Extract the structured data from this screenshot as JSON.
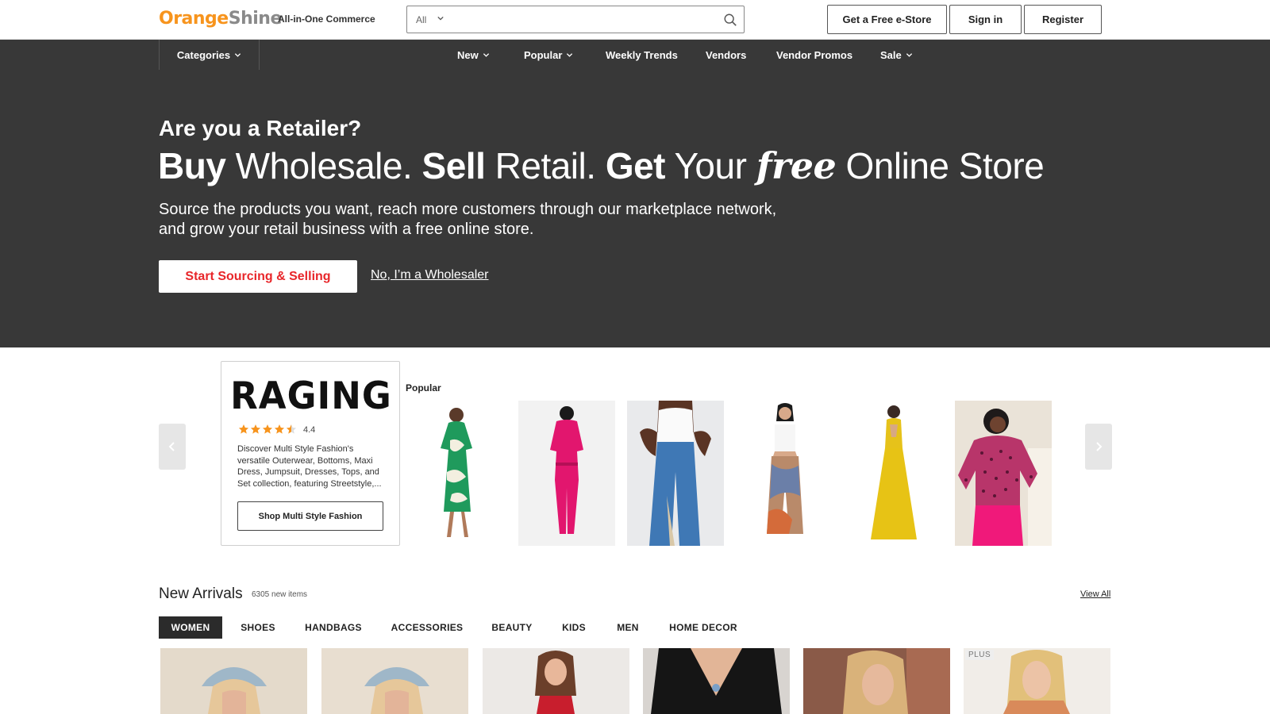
{
  "header": {
    "logo_part1": "Orange",
    "logo_part2": "Shine",
    "tagline": "All-in-One Commerce",
    "search_category": "All",
    "search_placeholder": "",
    "buttons": {
      "estore": "Get a Free e-Store",
      "signin": "Sign in",
      "register": "Register"
    }
  },
  "nav": {
    "categories": "Categories",
    "items": [
      {
        "label": "New"
      },
      {
        "label": "Popular"
      },
      {
        "label": "Weekly Trends"
      },
      {
        "label": "Vendors"
      },
      {
        "label": "Vendor Promos"
      },
      {
        "label": "Sale"
      }
    ]
  },
  "hero": {
    "question": "Are you a Retailer?",
    "headline": {
      "w1": "Buy",
      "w2": " Wholesale. ",
      "w3": "Sell",
      "w4": " Retail. ",
      "w5": "Get",
      "w6": " Your ",
      "w7": "free",
      "w8": " Online Store"
    },
    "sub_line1": "Source the products you want, reach more customers through our marketplace network,",
    "sub_line2": "and grow your retail business with a free online store.",
    "cta": "Start Sourcing & Selling",
    "alt_link": "No, I’m a Wholesaler"
  },
  "featured": {
    "vendor_logo": "RAGING",
    "rating": "4.4",
    "rating_value": 4.4,
    "description": "Discover Multi Style Fashion's versatile Outerwear, Bottoms, Maxi Dress, Jumpsuit, Dresses, Tops, and Set collection, featuring Streetstyle,...",
    "button": "Shop Multi Style Fashion",
    "popular_label": "Popular",
    "products": [
      {
        "name": "green-print-dress"
      },
      {
        "name": "magenta-jumpsuit"
      },
      {
        "name": "flare-jeans-bodysuit"
      },
      {
        "name": "printed-pants-outfit"
      },
      {
        "name": "yellow-maxi-dress"
      },
      {
        "name": "pink-polka-blouse-pants"
      }
    ]
  },
  "new_arrivals": {
    "title": "New Arrivals",
    "count": "6305 new items",
    "view_all": "View All",
    "tabs": [
      {
        "label": "WOMEN",
        "active": true
      },
      {
        "label": "SHOES"
      },
      {
        "label": "HANDBAGS"
      },
      {
        "label": "ACCESSORIES"
      },
      {
        "label": "BEAUTY"
      },
      {
        "label": "KIDS"
      },
      {
        "label": "MEN"
      },
      {
        "label": "HOME DECOR"
      }
    ],
    "plus_badge": "PLUS"
  },
  "colors": {
    "brand_orange": "#f7941d",
    "brand_gray": "#8a8a8a",
    "hero_bg": "#383838",
    "cta_red": "#e8262a",
    "star": "#f7941d"
  }
}
